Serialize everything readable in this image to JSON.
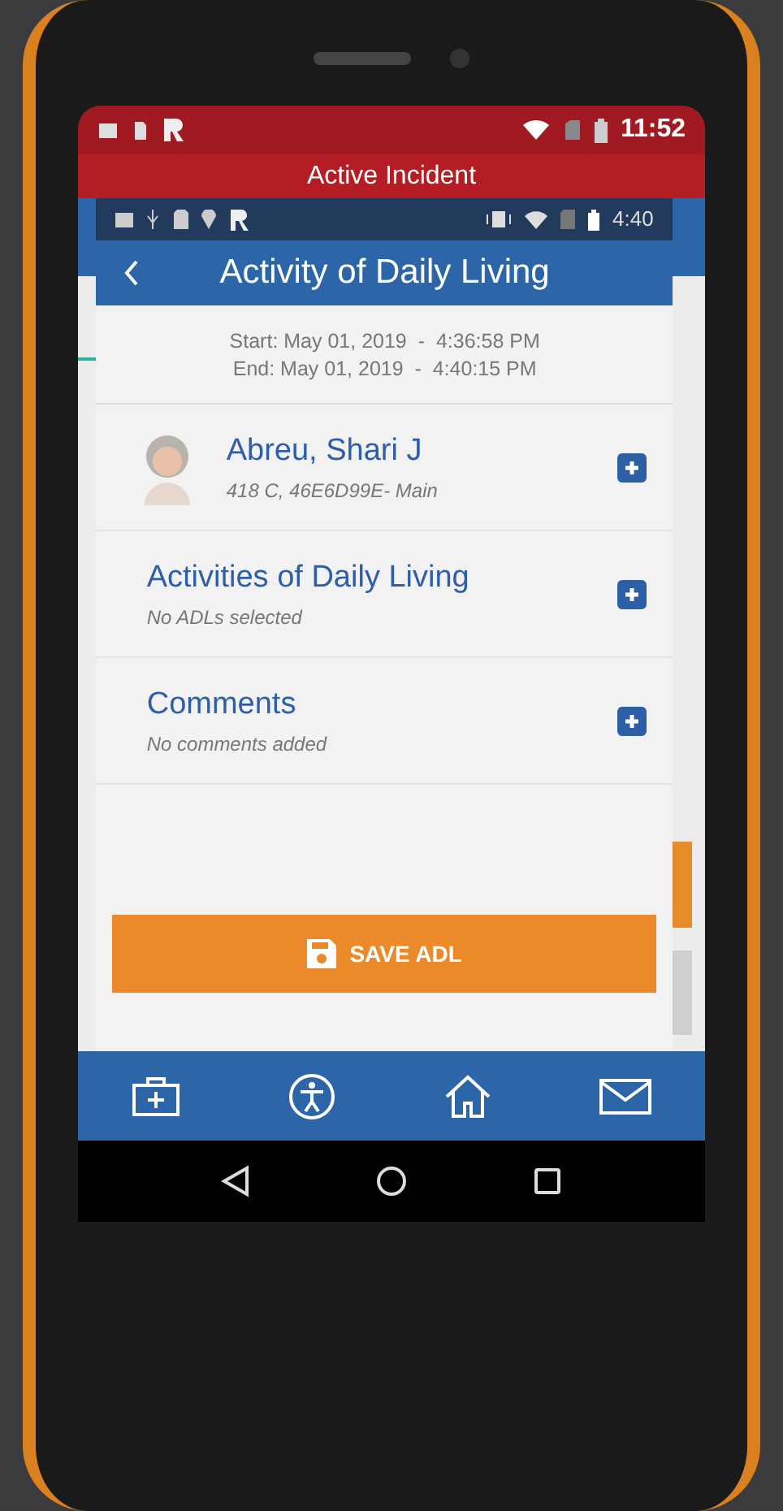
{
  "outer_status_bar": {
    "time": "11:52"
  },
  "incident_banner": {
    "title": "Active Incident"
  },
  "inner_status_bar": {
    "time": "4:40"
  },
  "header": {
    "title": "Activity of Daily Living"
  },
  "session": {
    "start": "Start: May 01, 2019  -  4:36:58 PM",
    "end": "End: May 01, 2019  -  4:40:15 PM"
  },
  "patient": {
    "name": "Abreu, Shari J",
    "detail": "418 C, 46E6D99E- Main"
  },
  "sections": [
    {
      "title": "Activities of Daily Living",
      "subtitle": "No ADLs selected"
    },
    {
      "title": "Comments",
      "subtitle": "No comments added"
    }
  ],
  "save_button": {
    "label": "SAVE ADL"
  }
}
